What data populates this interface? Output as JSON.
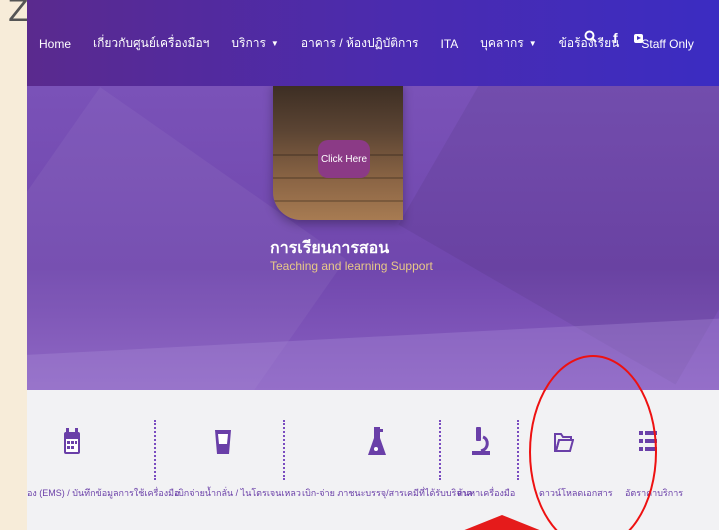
{
  "corner_glyph": "Z",
  "navbar": {
    "items": [
      {
        "label": "Home",
        "has_caret": false
      },
      {
        "label": "เกี่ยวกับศูนย์เครื่องมือฯ",
        "has_caret": false
      },
      {
        "label": "บริการ",
        "has_caret": true
      },
      {
        "label": "อาคาร / ห้องปฏิบัติการ",
        "has_caret": false
      },
      {
        "label": "ITA",
        "has_caret": false
      },
      {
        "label": "บุคลากร",
        "has_caret": true
      },
      {
        "label": "ข้อร้องเรียน",
        "has_caret": false
      },
      {
        "label": "Staff Only",
        "has_caret": false
      }
    ],
    "caret": "▼",
    "icons": {
      "search": "🔍",
      "facebook": "f"
    }
  },
  "hero": {
    "button_label": "Click Here",
    "title": "การเรียนการสอน",
    "subtitle": "Teaching and learning Support"
  },
  "services": [
    {
      "label": "อง (EMS) / บันทึกข้อมูลการใช้เครื่องมือ",
      "icon": "calendar-icon"
    },
    {
      "label": "เบิกจ่ายน้ำกลั่น / ไนโตรเจนเหลว",
      "icon": "cup-icon"
    },
    {
      "label": "เบิก-จ่าย ภาชนะบรรจุ/สารเคมีที่ได้รับบริจาค",
      "icon": "flask-icon"
    },
    {
      "label": "ค้นหาเครื่องมือ",
      "icon": "microscope-icon"
    },
    {
      "label": "ดาวน์โหลดเอกสาร",
      "icon": "folder-icon"
    },
    {
      "label": "อัตราค่าบริการ",
      "icon": "list-icon"
    }
  ],
  "colors": {
    "accent_purple": "#6a3fa8",
    "annotation_red": "#e11"
  }
}
